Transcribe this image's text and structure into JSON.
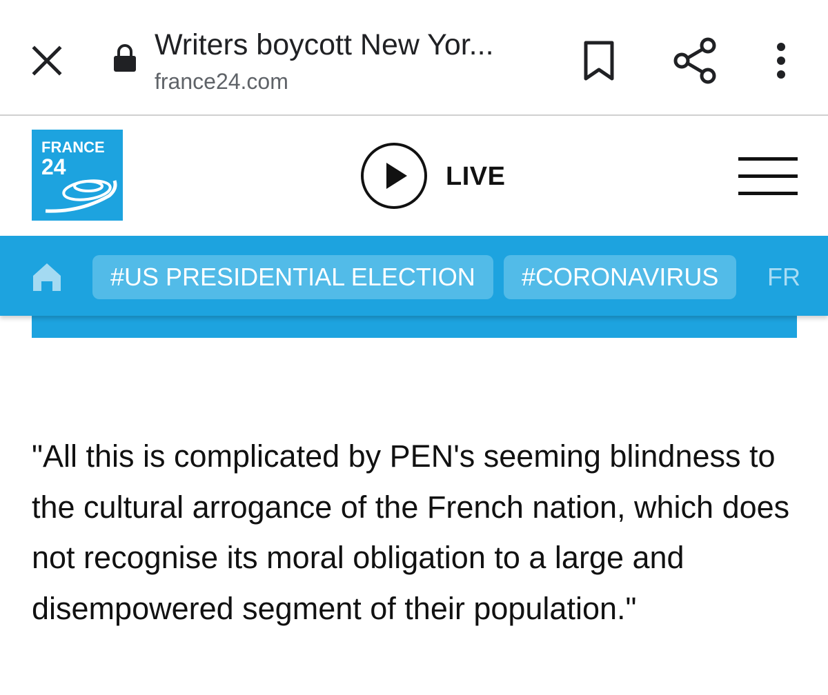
{
  "toolbar": {
    "page_title": "Writers boycott New Yor...",
    "url": "france24.com"
  },
  "site": {
    "logo": {
      "word": "FRANCE",
      "number": "24"
    },
    "live_label": "LIVE",
    "nav": {
      "chips": [
        "#US PRESIDENTIAL ELECTION",
        "#CORONAVIRUS"
      ],
      "more": "FR"
    }
  },
  "article": {
    "quote": "\"All this is complicated by PEN's seeming blindness to the cultural arrogance of the French nation, which does not recognise its moral obligation to a large and disempowered segment of their population.\""
  },
  "colors": {
    "brand_blue": "#1da3df",
    "chip_bg": "#52bbe8",
    "text": "#111111"
  },
  "icons": [
    "close-icon",
    "lock-icon",
    "bookmark-icon",
    "share-icon",
    "more-vert-icon",
    "play-icon",
    "hamburger-menu-icon",
    "home-icon"
  ]
}
